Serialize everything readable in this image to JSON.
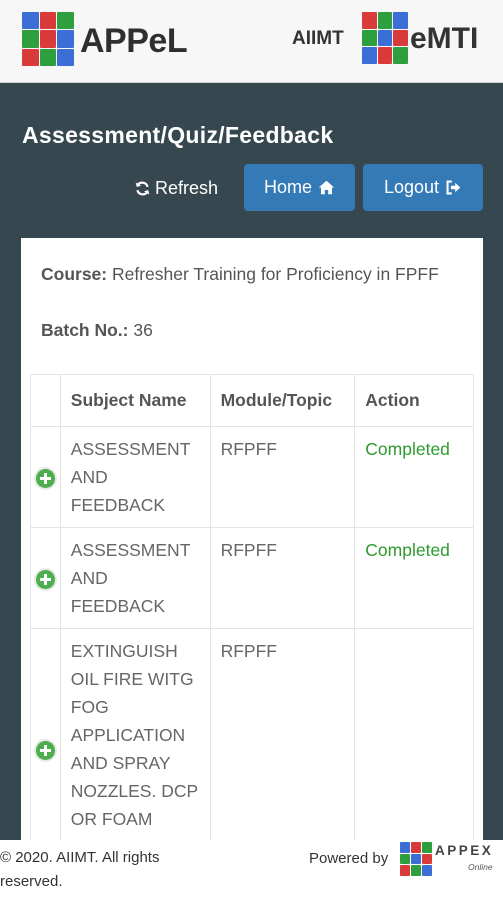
{
  "header": {
    "left_brand": "APPeL",
    "org_label": "AIIMT",
    "right_brand": "eMTI"
  },
  "page": {
    "title": "Assessment/Quiz/Feedback"
  },
  "actions": {
    "refresh_label": "Refresh",
    "home_label": "Home",
    "logout_label": "Logout"
  },
  "course": {
    "course_label": "Course:",
    "course_value": "Refresher Training for Proficiency in FPFF",
    "batch_label": "Batch No.:",
    "batch_value": "36"
  },
  "table": {
    "headers": {
      "subject": "Subject Name",
      "module": "Module/Topic",
      "action": "Action"
    },
    "rows": [
      {
        "subject": "ASSESSMENT AND FEEDBACK",
        "module": "RFPFF",
        "action": "Completed"
      },
      {
        "subject": "ASSESSMENT AND FEEDBACK",
        "module": "RFPFF",
        "action": "Completed"
      },
      {
        "subject": "EXTINGUISH OIL FIRE WITG FOG APPLICATION AND SPRAY NOZZLES. DCP OR FOAM APPLICATORS",
        "module": "RFPFF",
        "action": ""
      }
    ]
  },
  "footer": {
    "copyright": "© 2020. AIIMT. All rights reserved.",
    "powered_by": "Powered by",
    "appex_name": "APPEX",
    "appex_sub": "Online"
  },
  "colors": {
    "body_bg": "#37474f",
    "primary_button": "#337ab7",
    "completed_status": "#2e9a2e",
    "expand_icon": "#4cae4c"
  },
  "icons": [
    "app-logo-cube-icon",
    "refresh-icon",
    "home-icon",
    "logout-icon",
    "expand-plus-icon"
  ]
}
